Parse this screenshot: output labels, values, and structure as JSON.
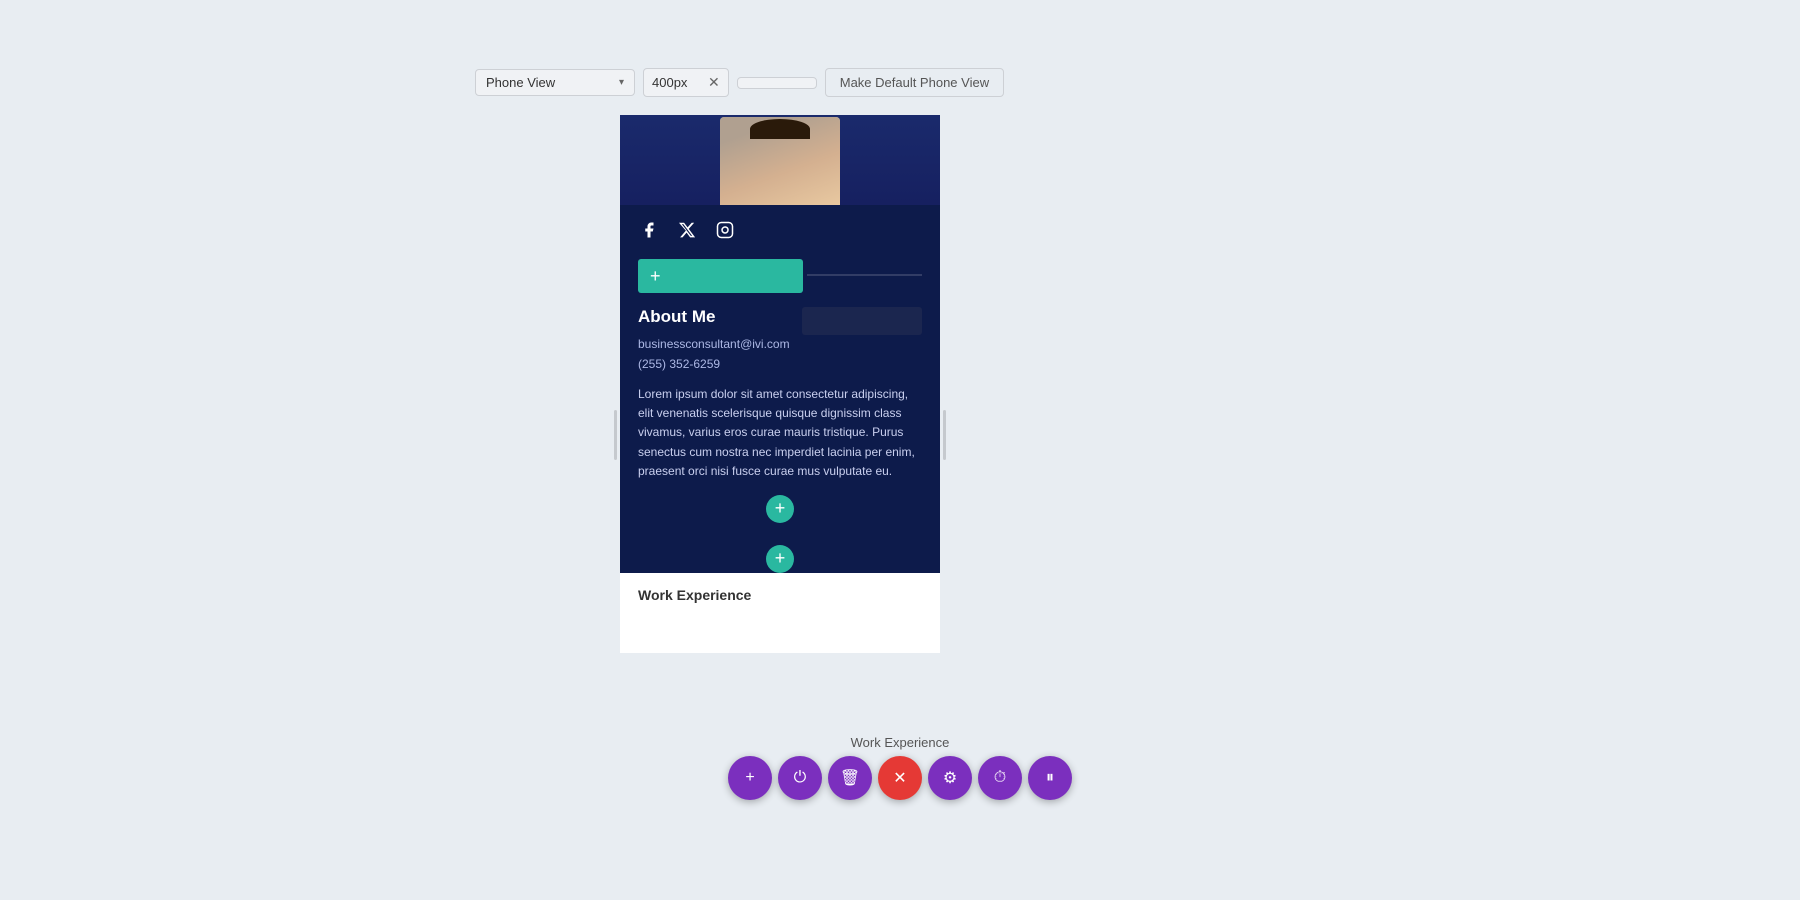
{
  "toolbar": {
    "view_label": "Phone View",
    "px_value": "400px",
    "make_default_label": "Make Default Phone View"
  },
  "phone": {
    "social": {
      "facebook_label": "facebook",
      "twitter_label": "twitter",
      "instagram_label": "instagram"
    },
    "add_bar_plus": "+",
    "about": {
      "title": "About Me",
      "email": "businessconsultant@ivi.com",
      "phone": "(255) 352-6259",
      "bio": "Lorem ipsum dolor sit amet consectetur adipiscing, elit venenatis scelerisque quisque dignissim class vivamus, varius eros curae mauris tristique. Purus senectus cum nostra nec imperdiet lacinia per enim, praesent orci nisi fusce curae mus vulputate eu."
    },
    "section_add_plus": "+",
    "work_exp_label": "Work Experience"
  },
  "bottom_toolbar": {
    "add_icon": "+",
    "power_icon": "⏻",
    "trash_icon": "🗑",
    "close_icon": "✕",
    "settings_icon": "⚙",
    "clock_icon": "⏱",
    "pause_icon": "⏸"
  }
}
